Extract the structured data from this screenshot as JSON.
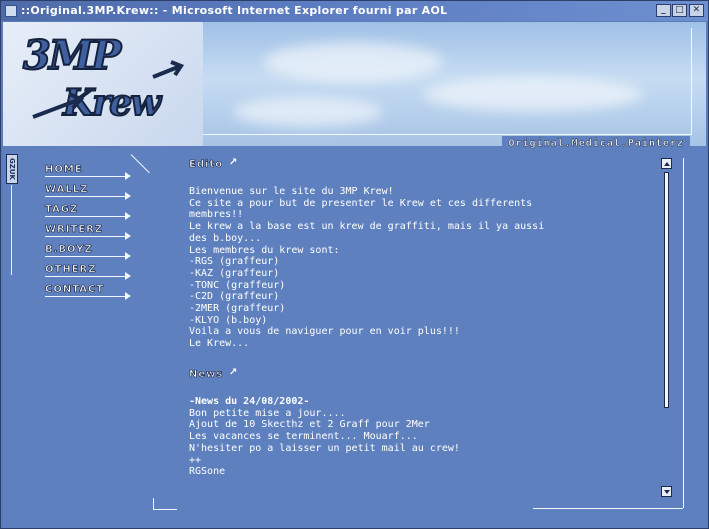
{
  "window": {
    "title": "::Original.3MP.Krew:: - Microsoft Internet Explorer fourni par AOL",
    "buttons": {
      "minimize": "_",
      "maximize": "□",
      "close": "✕"
    }
  },
  "header": {
    "logo_line1": "3MP",
    "logo_line2": "Krew",
    "tagline": "Original.Medical.Painterz"
  },
  "sidetab": "GZUK",
  "nav": [
    {
      "label": "Home"
    },
    {
      "label": "Wallz"
    },
    {
      "label": "Tagz"
    },
    {
      "label": "Writerz"
    },
    {
      "label": "B.Boyz"
    },
    {
      "label": "Otherz"
    },
    {
      "label": "Contact"
    }
  ],
  "edito": {
    "heading": "Edito",
    "lines": [
      "Bienvenue sur le site du 3MP Krew!",
      "Ce site a pour but de presenter le Krew et ces differents",
      "membres!!",
      "Le krew a la base est un krew de graffiti, mais il ya aussi",
      "des b.boy...",
      "Les membres du krew sont:",
      "-RGS (graffeur)",
      "-KAZ (graffeur)",
      "-TONC (graffeur)",
      "-C2D (graffeur)",
      "-2MER (graffeur)",
      "-KLYO (b.boy)",
      "Voila a vous de naviguer pour en voir plus!!!",
      "Le Krew..."
    ]
  },
  "news": {
    "heading": "News",
    "date": "-News du 24/08/2002-",
    "lines": [
      "Bon petite mise a jour....",
      "Ajout de 10 Skecthz et 2 Graff pour 2Mer",
      "Les vacances se terminent... Mouarf...",
      "N'hesiter po a laisser un petit mail au crew!",
      "++",
      "RGSone"
    ]
  },
  "colors": {
    "background": "#5e80bf",
    "sky": "#c6dcf2",
    "text": "#ffffff",
    "titlebar": "#5b7bc0"
  }
}
